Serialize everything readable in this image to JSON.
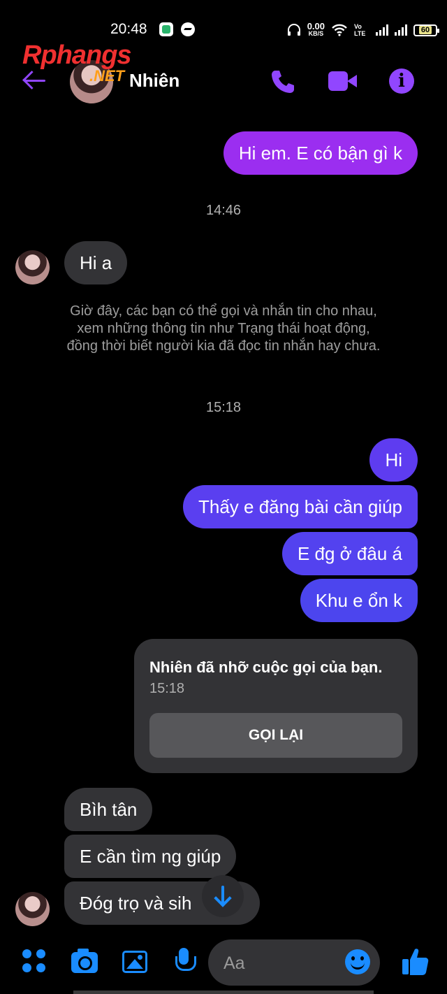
{
  "status_bar": {
    "time": "20:48",
    "speed_value": "0.00",
    "speed_unit": "KB/S",
    "volte": "Vo LTE",
    "battery": "60"
  },
  "watermark": {
    "brand": "Rphangs",
    "suffix": ".NET"
  },
  "header": {
    "contact_name": "Nhiên",
    "accent_color": "#9146ff"
  },
  "messages": [
    {
      "dir": "out",
      "text": "Hi em. E có bận gì k",
      "color": "#9b2ef0"
    },
    {
      "type": "timestamp",
      "text": "14:46"
    },
    {
      "dir": "in",
      "text": "Hi a"
    },
    {
      "type": "system",
      "text": "Giờ đây, các bạn có thể gọi và nhắn tin cho nhau, xem những thông tin như Trạng thái hoạt động, đồng thời biết người kia đã đọc tin nhắn hay chưa."
    },
    {
      "type": "timestamp",
      "text": "15:18"
    },
    {
      "dir": "out",
      "text": "Hi",
      "color": "#5e3cf0"
    },
    {
      "dir": "out",
      "text": "Thấy e đăng bài cần giúp",
      "color": "#5a3ff0"
    },
    {
      "dir": "out",
      "text": "E đg ở đâu á",
      "color": "#5342ef"
    },
    {
      "dir": "out",
      "text": "Khu e ổn k",
      "color": "#4c45ee"
    },
    {
      "dir": "in",
      "text": "Bìh tân"
    },
    {
      "dir": "in",
      "text": "E cần tìm ng giúp"
    },
    {
      "dir": "in",
      "text": "Đóg trọ và sih"
    }
  ],
  "missed_call": {
    "title": "Nhiên đã nhỡ cuộc gọi của bạn.",
    "time": "15:18",
    "action": "GỌI LẠI"
  },
  "composer": {
    "placeholder": "Aa",
    "accent_color": "#1a8cff",
    "icons": [
      "menu-icon",
      "camera-icon",
      "gallery-icon",
      "microphone-icon",
      "emoji-icon",
      "thumbs-up-icon"
    ]
  }
}
